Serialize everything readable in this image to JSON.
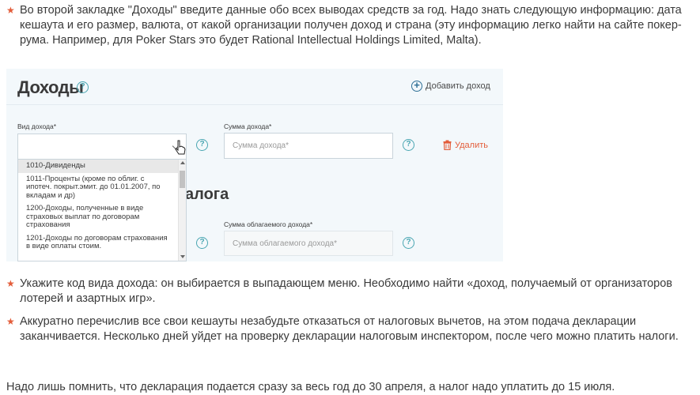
{
  "bullets_top": [
    "Во второй закладке \"Доходы\" введите данные обо всех выводах средств за год. Надо знать следующую информацию: дата кешаута и его размер, валюта, от какой организации получен доход и страна (эту информацию легко найти на сайте покер-рума. Например, для Poker Stars это будет Rational Intellectual Holdings Limited, Malta)."
  ],
  "form": {
    "title": "Доходы",
    "add_label": "Добавить доход",
    "income_type_label": "Вид дохода*",
    "income_sum_label": "Сумма дохода*",
    "income_sum_placeholder": "Сумма дохода*",
    "delete_label": "Удалить",
    "section2_title_fragment": "алога",
    "taxable_sum_label": "Сумма облагаемого дохода*",
    "taxable_sum_placeholder": "Сумма облагаемого дохода*",
    "dropdown_options": [
      "1010-Дивиденды",
      "1011-Проценты (кроме по облиг. с ипотеч. покрыт.эмит. до 01.01.2007, по вкладам и др)",
      "1200-Доходы, полученные в виде страховых выплат по договорам страхования",
      "1201-Доходы по договорам страхования в виде оплаты стоим."
    ]
  },
  "bullets_bottom": [
    "Укажите код вида дохода: он выбирается в выпадающем меню. Необходимо найти «доход, получаемый от организаторов лотерей и азартных игр».",
    "Аккуратно перечислив все свои кешауты незабудьте отказаться от налоговых вычетов, на этом подача декларации заканчивается. Несколько дней уйдет на проверку декларации налоговым инспектором, после чего можно платить налоги."
  ],
  "footer_text": "Надо лишь помнить, что декларация подается сразу за весь год до 30 апреля, а налог надо уплатить до 15 июля.",
  "colors": {
    "accent_star": "#e35d3a",
    "help_icon": "#4aa6b2",
    "form_bg": "#f3f8fb",
    "delete": "#e35d3a"
  },
  "icons": [
    "star-bullet-icon",
    "help-icon",
    "plus-circle-icon",
    "trash-icon",
    "chevron-down-icon",
    "hand-cursor-icon"
  ]
}
